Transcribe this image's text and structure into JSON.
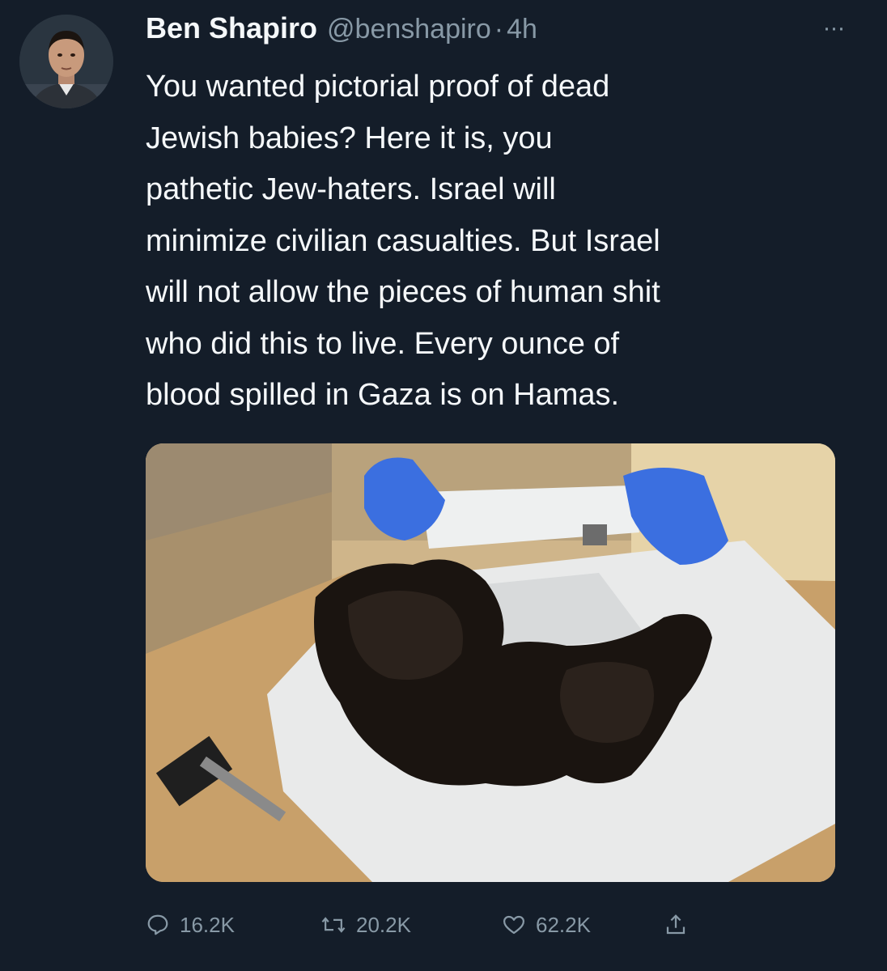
{
  "tweet": {
    "display_name": "Ben Shapiro",
    "handle": "@benshapiro",
    "separator": "·",
    "time": "4h",
    "more_label": "···",
    "text_lines": [
      "You wanted pictorial proof of dead",
      "Jewish babies? Here it is, you",
      "pathetic Jew-haters. Israel will",
      "minimize civilian casualties. But Israel",
      "will not allow the pieces of human shit",
      "who did this to live. Every ounce of",
      "blood spilled in Gaza is on Hamas."
    ]
  },
  "actions": {
    "reply": {
      "icon": "reply-icon",
      "count": "16.2K"
    },
    "retweet": {
      "icon": "retweet-icon",
      "count": "20.2K"
    },
    "like": {
      "icon": "heart-icon",
      "count": "62.2K"
    },
    "share": {
      "icon": "share-icon"
    }
  },
  "colors": {
    "background": "#141d29",
    "primary_text": "#f5f8fa",
    "secondary_text": "#8899a6"
  }
}
